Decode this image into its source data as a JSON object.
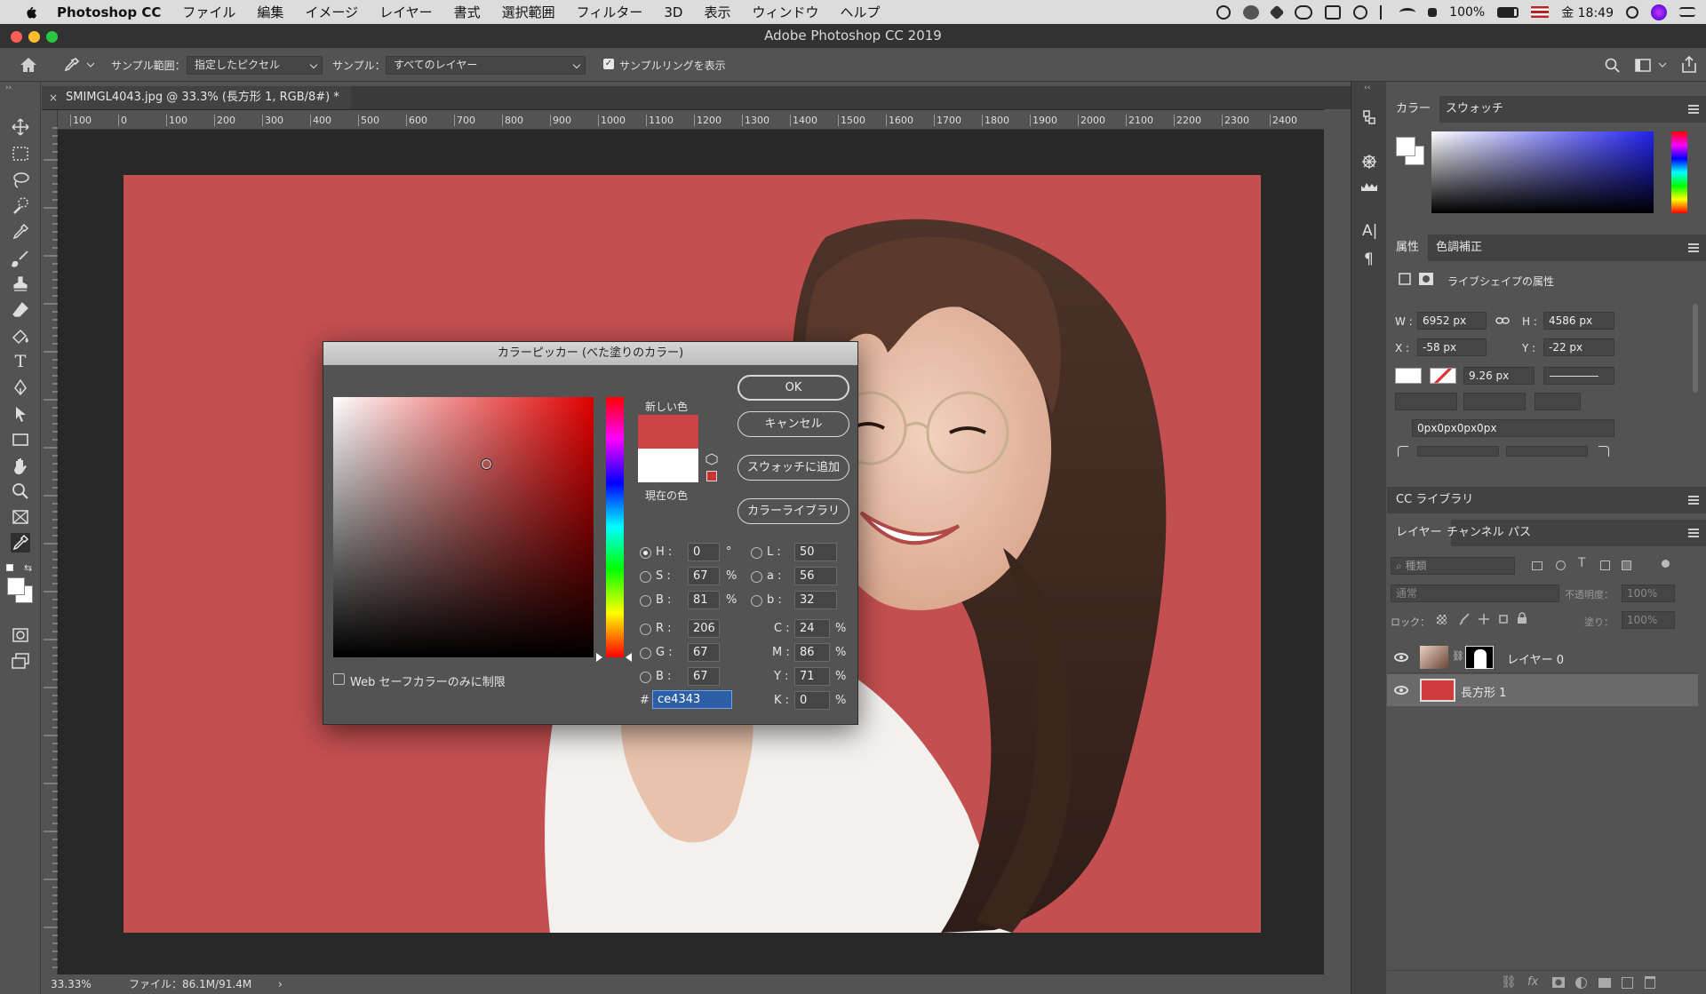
{
  "menubar": {
    "app_name": "Photoshop CC",
    "items": [
      "ファイル",
      "編集",
      "イメージ",
      "レイヤー",
      "書式",
      "選択範囲",
      "フィルター",
      "3D",
      "表示",
      "ウィンドウ",
      "ヘルプ"
    ],
    "battery": "100%",
    "clock": "金 18:49"
  },
  "window": {
    "title": "Adobe Photoshop CC 2019"
  },
  "options": {
    "sample_size_label": "サンプル範囲：",
    "sample_size_value": "指定したピクセル",
    "sample_label": "サンプル：",
    "sample_value": "すべてのレイヤー",
    "show_ring_label": "サンプルリングを表示"
  },
  "document": {
    "tab_title": "SMIMGL4043.jpg @ 33.3% (長方形 1, RGB/8#) *",
    "ruler_ticks": [
      "100",
      "0",
      "100",
      "200",
      "300",
      "400",
      "500",
      "600",
      "700",
      "800",
      "900",
      "1000",
      "1100",
      "1200",
      "1300",
      "1400",
      "1500",
      "1600",
      "1700",
      "1800",
      "1900",
      "2000",
      "2100",
      "2200",
      "2300",
      "2400"
    ],
    "zoom": "33.33%",
    "file_info": "ファイル：86.1M/91.4M",
    "canvas_color": "#c44f50"
  },
  "color_picker": {
    "title": "カラーピッカー (べた塗りのカラー)",
    "new_label": "新しい色",
    "current_label": "現在の色",
    "new_color": "#ce4343",
    "current_color": "#ffffff",
    "buttons": {
      "ok": "OK",
      "cancel": "キャンセル",
      "add_swatch": "スウォッチに追加",
      "color_library": "カラーライブラリ"
    },
    "web_only_label": "Web セーフカラーのみに制限",
    "fields": {
      "H": {
        "label": "H :",
        "value": "0",
        "unit": "°"
      },
      "S": {
        "label": "S :",
        "value": "67",
        "unit": "%"
      },
      "Bv": {
        "label": "B :",
        "value": "81",
        "unit": "%"
      },
      "R": {
        "label": "R :",
        "value": "206"
      },
      "G": {
        "label": "G :",
        "value": "67"
      },
      "B": {
        "label": "B :",
        "value": "67"
      },
      "L": {
        "label": "L :",
        "value": "50"
      },
      "a": {
        "label": "a :",
        "value": "56"
      },
      "b": {
        "label": "b :",
        "value": "32"
      },
      "C": {
        "label": "C :",
        "value": "24",
        "unit": "%"
      },
      "M": {
        "label": "M :",
        "value": "86",
        "unit": "%"
      },
      "Y": {
        "label": "Y :",
        "value": "71",
        "unit": "%"
      },
      "K": {
        "label": "K :",
        "value": "0",
        "unit": "%"
      }
    },
    "hex_label": "#",
    "hex_value": "ce4343"
  },
  "panels": {
    "color_tabs": [
      "カラー",
      "スウォッチ"
    ],
    "props_tabs": [
      "属性",
      "色調補正"
    ],
    "live_shape_label": "ライブシェイプの属性",
    "W": {
      "label": "W :",
      "value": "6952 px"
    },
    "H": {
      "label": "H :",
      "value": "4586 px"
    },
    "X": {
      "label": "X :",
      "value": "-58 px"
    },
    "Y": {
      "label": "Y :",
      "value": "-22 px"
    },
    "stroke_width": "9.26 px",
    "radius": "0px0px0px0px",
    "cc_library": "CC ライブラリ",
    "layer_tabs": [
      "レイヤー",
      "チャンネル",
      "パス"
    ],
    "search_placeholder": "種類",
    "blend_mode": "通常",
    "opacity_label": "不透明度：",
    "opacity_value": "100%",
    "lock_label": "ロック：",
    "fill_label": "塗り：",
    "fill_value": "100%",
    "layers": [
      {
        "name": "レイヤー 0"
      },
      {
        "name": "長方形 1"
      }
    ]
  }
}
